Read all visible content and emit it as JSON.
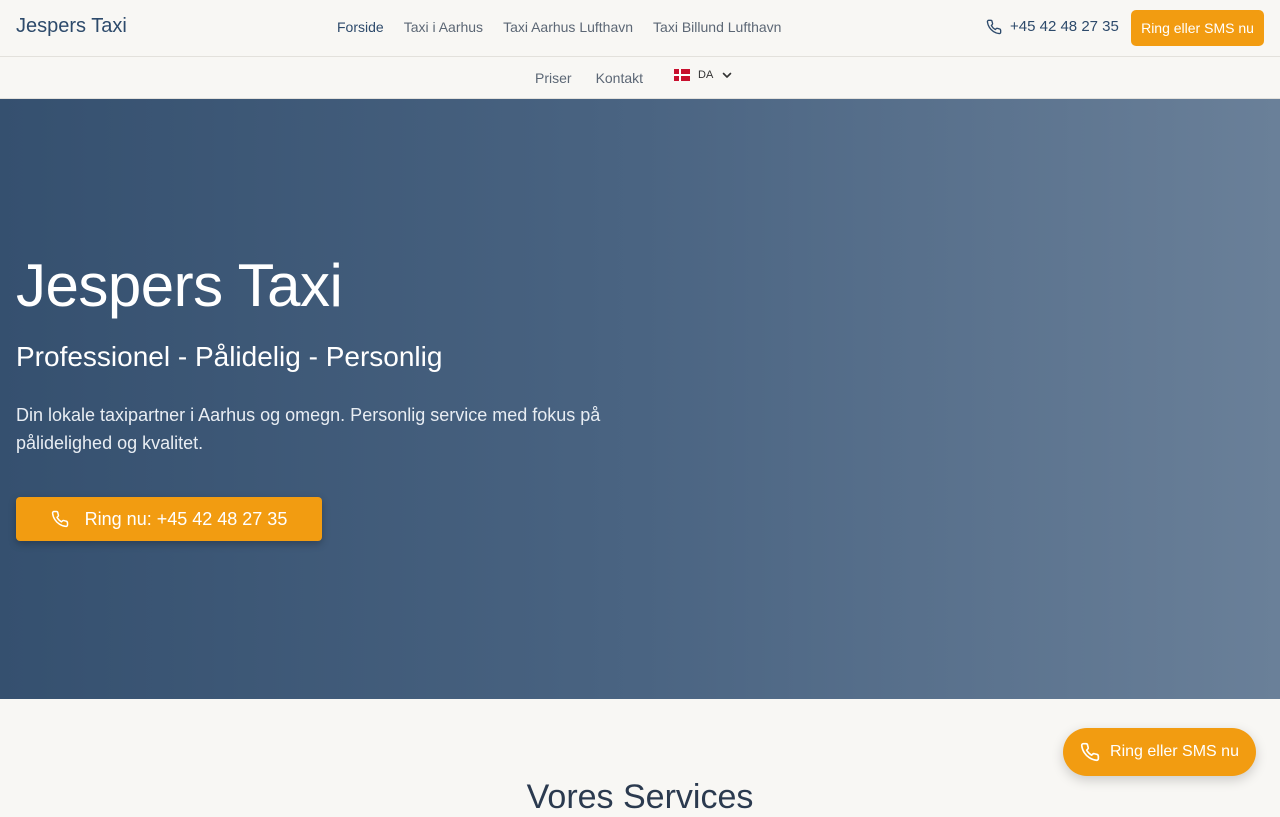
{
  "header": {
    "brand": "Jespers Taxi",
    "nav": [
      "Forside",
      "Taxi i Aarhus",
      "Taxi Aarhus Lufthavn",
      "Taxi Billund Lufthavn"
    ],
    "active_nav": "Forside",
    "phone": "+45 42 48 27 35",
    "cta": "Ring eller SMS nu"
  },
  "subnav": {
    "links": [
      "Priser",
      "Kontakt"
    ],
    "language": "DA"
  },
  "hero": {
    "title": "Jespers Taxi",
    "subtitle": "Professionel - Pålidelig - Personlig",
    "description": "Din lokale taxipartner i Aarhus og omegn. Personlig service med fokus på pålidelighed og kvalitet.",
    "cta": "Ring nu: +45 42 48 27 35"
  },
  "services": {
    "title": "Vores Services"
  },
  "floating_cta": "Ring eller SMS nu",
  "colors": {
    "accent": "#f29c11",
    "brand": "#2d4a6b",
    "hero_start": "#35506f",
    "hero_end": "#6a8099",
    "background": "#f8f7f4"
  },
  "icons": {
    "phone": "phone-icon",
    "flag": "danish-flag-icon",
    "chevron": "chevron-down-icon"
  }
}
